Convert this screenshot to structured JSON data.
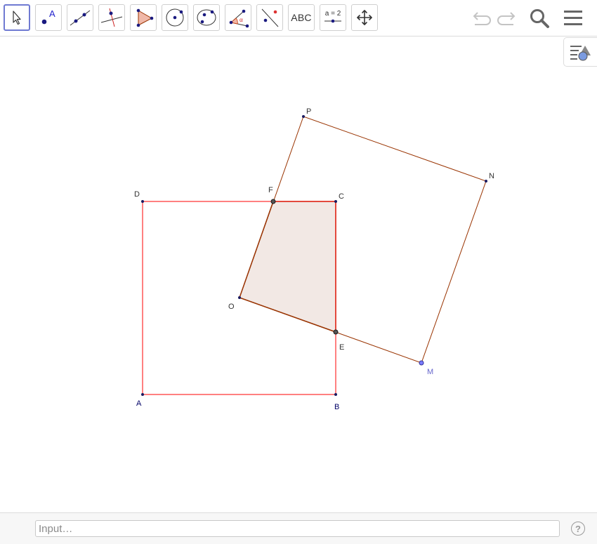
{
  "toolbar": {
    "tools": [
      {
        "name": "move-tool-icon",
        "selected": true
      },
      {
        "name": "point-tool-icon",
        "text": "A"
      },
      {
        "name": "line-tool-icon"
      },
      {
        "name": "perpendicular-line-tool-icon"
      },
      {
        "name": "polygon-tool-icon"
      },
      {
        "name": "circle-tool-icon"
      },
      {
        "name": "conic-tool-icon"
      },
      {
        "name": "angle-tool-icon",
        "text": "α"
      },
      {
        "name": "reflect-tool-icon"
      },
      {
        "name": "text-tool-icon",
        "text": "ABC"
      },
      {
        "name": "slider-tool-icon",
        "text": "a = 2"
      },
      {
        "name": "move-graphics-view-tool-icon"
      }
    ],
    "right_icons": [
      "undo-icon",
      "redo-icon",
      "search-icon",
      "menu-icon"
    ]
  },
  "style_bar": {
    "icon": "style-bar-toggle-icon"
  },
  "construction": {
    "colors": {
      "square_abcd": "#ff0000",
      "square_mnpo": "#993300",
      "overlap_fill": "#f2e8e4",
      "point": "#1a1a60",
      "free_point": "#7b7bff"
    },
    "points": [
      {
        "label": "A"
      },
      {
        "label": "B"
      },
      {
        "label": "C"
      },
      {
        "label": "D"
      },
      {
        "label": "P"
      },
      {
        "label": "N"
      },
      {
        "label": "M"
      },
      {
        "label": "O"
      },
      {
        "label": "F"
      },
      {
        "label": "E"
      }
    ]
  },
  "input_bar": {
    "placeholder": "Input…",
    "help_icon": "help-icon",
    "help_text": "?"
  }
}
